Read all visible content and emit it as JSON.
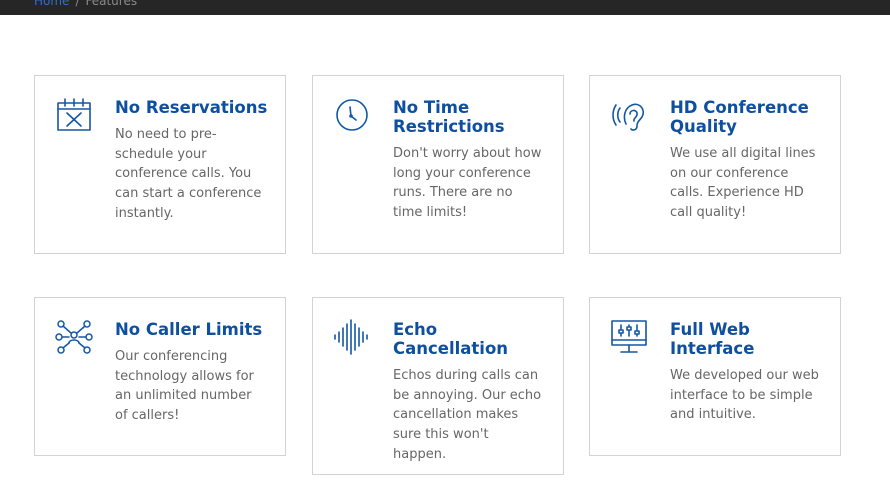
{
  "breadcrumb": {
    "home": "Home",
    "separator": "/",
    "current": "Features"
  },
  "colors": {
    "accent": "#0e4f9f",
    "icon": "#1457a6",
    "text": "#666666",
    "border": "#d3d3d3",
    "topbar": "#262626"
  },
  "features": [
    {
      "icon": "calendar-x-icon",
      "title": "No Reservations",
      "desc": "No need to pre-schedule your conference calls. You can start a conference instantly."
    },
    {
      "icon": "clock-icon",
      "title": "No Time Restrictions",
      "desc": "Don't worry about how long your conference runs. There are no time limits!"
    },
    {
      "icon": "hearing-ear-icon",
      "title": "HD Conference Quality",
      "desc": "We use all digital lines on our conference calls. Experience HD call quality!"
    },
    {
      "icon": "network-people-icon",
      "title": "No Caller Limits",
      "desc": "Our conferencing technology allows for an unlimited number of callers!"
    },
    {
      "icon": "sound-wave-icon",
      "title": "Echo Cancellation",
      "desc": "Echos during calls can be annoying. Our echo cancellation makes sure this won't happen."
    },
    {
      "icon": "monitor-sliders-icon",
      "title": "Full Web Interface",
      "desc": "We developed our web interface to be simple and intuitive."
    }
  ]
}
